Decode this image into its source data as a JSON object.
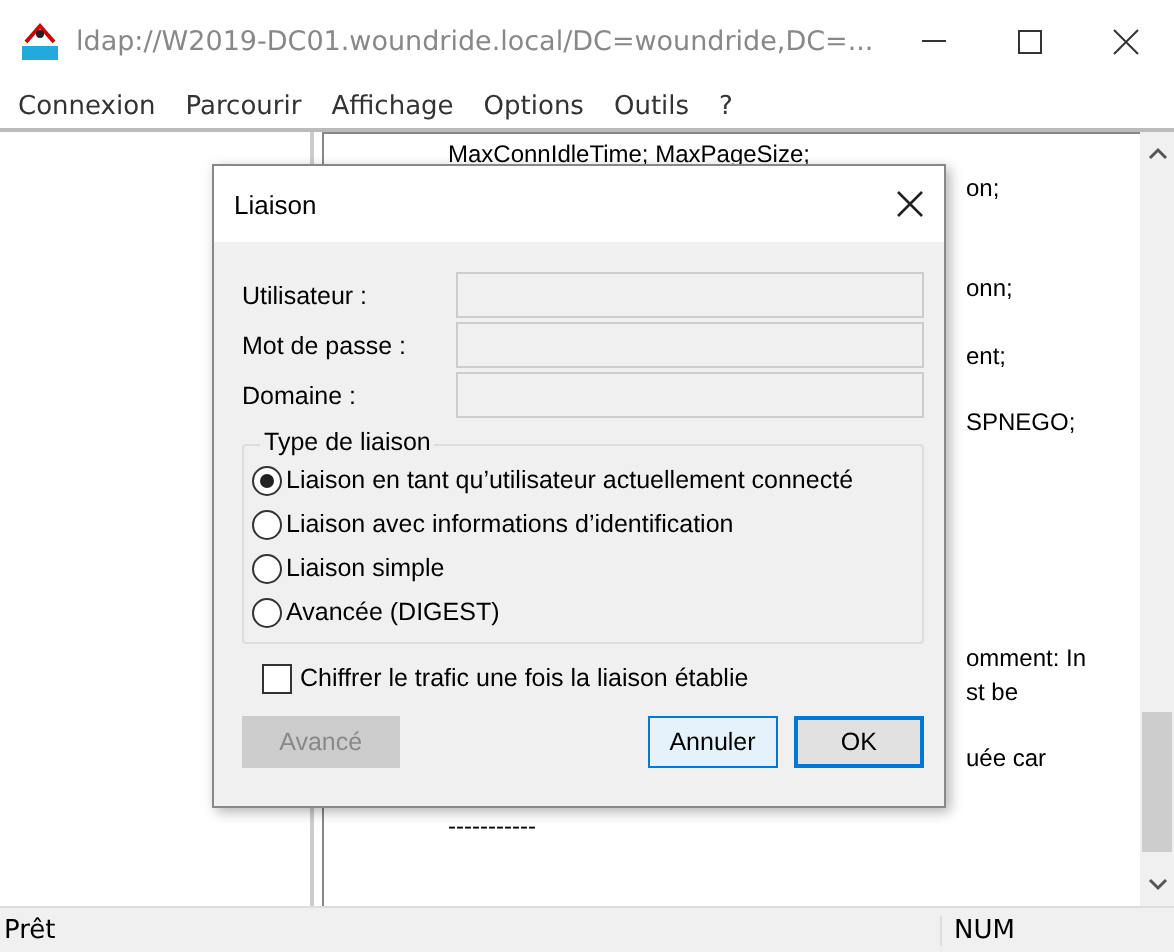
{
  "window": {
    "title": "ldap://W2019-DC01.woundride.local/DC=woundride,DC=..."
  },
  "menu": [
    "Connexion",
    "Parcourir",
    "Affichage",
    "Options",
    "Outils",
    "?"
  ],
  "output_fragments": [
    "MaxConnIdleTime; MaxPageSize;",
    "on;",
    "onn;",
    "ent;",
    "SPNEGO;",
    "omment: In",
    "st be",
    "uée car",
    "-----------"
  ],
  "dialog": {
    "title": "Liaison",
    "fields": [
      {
        "label": "Utilisateur :"
      },
      {
        "label": "Mot de passe :"
      },
      {
        "label": "Domaine :"
      }
    ],
    "group_title": "Type de liaison",
    "options": [
      {
        "label": "Liaison en tant qu’utilisateur actuellement connecté",
        "selected": true
      },
      {
        "label": "Liaison avec informations d’identification",
        "selected": false
      },
      {
        "label": "Liaison simple",
        "selected": false
      },
      {
        "label": "Avancée (DIGEST)",
        "selected": false
      }
    ],
    "encrypt": {
      "label": "Chiffrer le trafic une fois la liaison établie",
      "checked": false
    },
    "buttons": [
      {
        "label": "Avancé",
        "disabled": true,
        "default": false
      },
      {
        "label": "Annuler",
        "disabled": false,
        "default": false
      },
      {
        "label": "OK",
        "disabled": false,
        "default": true
      }
    ]
  },
  "status_bar": {
    "text": "Prêt",
    "num": "NUM"
  }
}
